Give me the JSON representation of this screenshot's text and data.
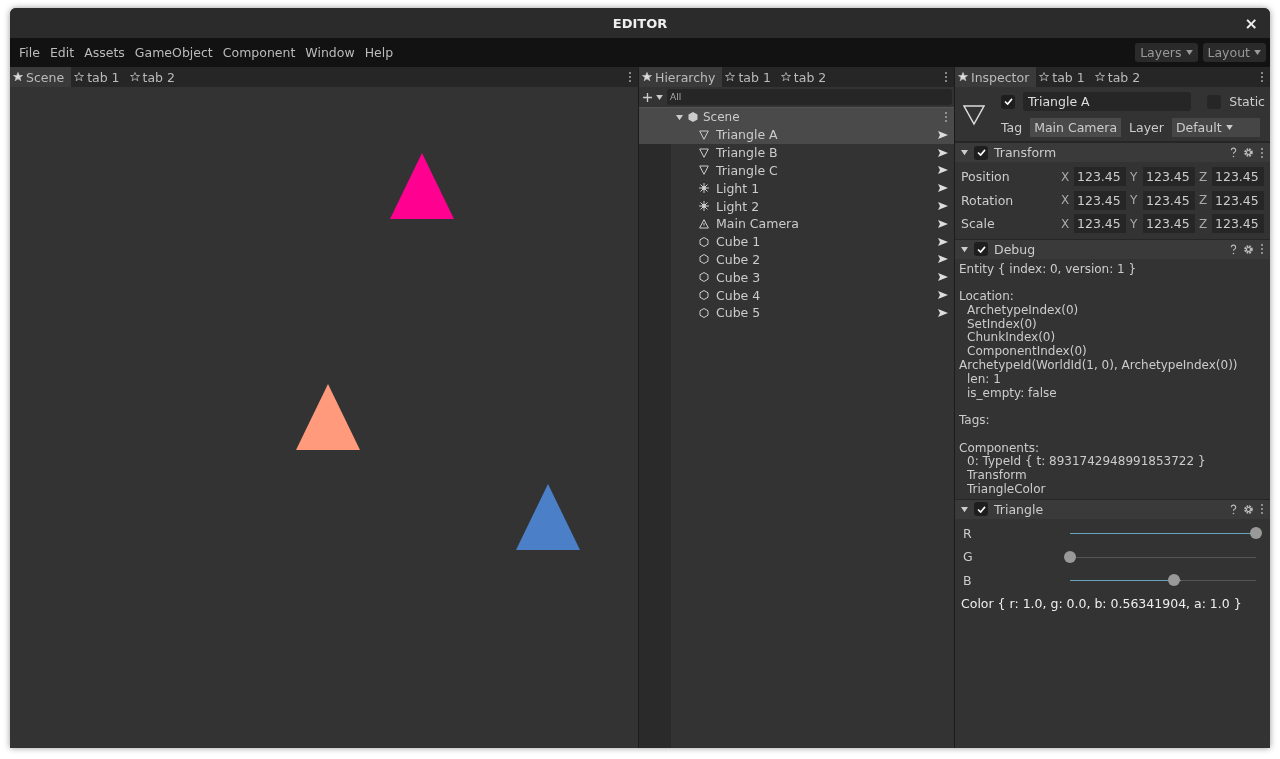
{
  "window": {
    "title": "EDITOR",
    "close": "×"
  },
  "menu": [
    "File",
    "Edit",
    "Assets",
    "GameObject",
    "Component",
    "Window",
    "Help"
  ],
  "menu_right": [
    {
      "label": "Layers"
    },
    {
      "label": "Layout"
    }
  ],
  "scene": {
    "tabs": [
      {
        "label": "Scene",
        "selected": true
      },
      {
        "label": "tab 1",
        "selected": false
      },
      {
        "label": "tab 2",
        "selected": false
      }
    ],
    "objects": [
      {
        "color": "#ff0090"
      },
      {
        "color": "#ff9a7c"
      },
      {
        "color": "#4b80c9"
      }
    ]
  },
  "hierarchy": {
    "tabs": [
      {
        "label": "Hierarchy",
        "selected": true
      },
      {
        "label": "tab 1",
        "selected": false
      },
      {
        "label": "tab 2",
        "selected": false
      }
    ],
    "filter": {
      "placeholder": "All"
    },
    "root": {
      "label": "Scene",
      "expanded": true,
      "children": [
        {
          "label": "Triangle A",
          "kind": "triangle",
          "selected": true
        },
        {
          "label": "Triangle B",
          "kind": "triangle",
          "selected": false
        },
        {
          "label": "Triangle C",
          "kind": "triangle",
          "selected": false
        },
        {
          "label": "Light 1",
          "kind": "light",
          "selected": false
        },
        {
          "label": "Light 2",
          "kind": "light",
          "selected": false
        },
        {
          "label": "Main Camera",
          "kind": "camera",
          "selected": false
        },
        {
          "label": "Cube 1",
          "kind": "cube",
          "selected": false
        },
        {
          "label": "Cube 2",
          "kind": "cube",
          "selected": false
        },
        {
          "label": "Cube 3",
          "kind": "cube",
          "selected": false
        },
        {
          "label": "Cube 4",
          "kind": "cube",
          "selected": false
        },
        {
          "label": "Cube 5",
          "kind": "cube",
          "selected": false
        }
      ]
    }
  },
  "inspector": {
    "tabs": [
      {
        "label": "Inspector",
        "selected": true
      },
      {
        "label": "tab 1",
        "selected": false
      },
      {
        "label": "tab 2",
        "selected": false
      }
    ],
    "object": {
      "active": true,
      "name": "Triangle A",
      "static": false,
      "static_label": "Static",
      "tag_label": "Tag",
      "tag": "Main Camera",
      "layer_label": "Layer",
      "layer": "Default"
    },
    "transform": {
      "title": "Transform",
      "enabled": true,
      "expanded": true,
      "rows": [
        {
          "label": "Position",
          "fields": [
            {
              "axis": "X",
              "value": "123.45"
            },
            {
              "axis": "Y",
              "value": "123.45"
            },
            {
              "axis": "Z",
              "value": "123.45"
            }
          ]
        },
        {
          "label": "Rotation",
          "fields": [
            {
              "axis": "X",
              "value": "123.45"
            },
            {
              "axis": "Y",
              "value": "123.45"
            },
            {
              "axis": "Z",
              "value": "123.45"
            }
          ]
        },
        {
          "label": "Scale",
          "fields": [
            {
              "axis": "X",
              "value": "123.45"
            },
            {
              "axis": "Y",
              "value": "123.45"
            },
            {
              "axis": "Z",
              "value": "123.45"
            }
          ]
        }
      ]
    },
    "debug": {
      "title": "Debug",
      "enabled": true,
      "expanded": true,
      "paragraphs": [
        [
          {
            "text": "Entity { index: 0, version: 1 }",
            "indented": false
          }
        ],
        [
          {
            "text": "Location:",
            "indented": false
          },
          {
            "text": "ArchetypeIndex(0)",
            "indented": true
          },
          {
            "text": "SetIndex(0)",
            "indented": true
          },
          {
            "text": "ChunkIndex(0)",
            "indented": true
          },
          {
            "text": "ComponentIndex(0)",
            "indented": true
          },
          {
            "text": "ArchetypeId(WorldId(1, 0), ArchetypeIndex(0))",
            "indented": false
          },
          {
            "text": "len: 1",
            "indented": true
          },
          {
            "text": "is_empty: false",
            "indented": true
          }
        ],
        [
          {
            "text": "Tags:",
            "indented": false
          }
        ],
        [
          {
            "text": "Components:",
            "indented": false
          },
          {
            "text": "0: TypeId { t: 8931742948991853722 }",
            "indented": true
          },
          {
            "text": "Transform",
            "indented": true
          },
          {
            "text": "TriangleColor",
            "indented": true
          }
        ]
      ]
    },
    "triangle": {
      "title": "Triangle",
      "enabled": true,
      "expanded": true,
      "sliders": [
        {
          "label": "R",
          "level": 1.0
        },
        {
          "label": "G",
          "level": 0.0
        },
        {
          "label": "B",
          "level": 0.56
        }
      ],
      "value": "Color { r: 1.0, g: 0.0, b: 0.56341904, a: 1.0 }"
    }
  }
}
